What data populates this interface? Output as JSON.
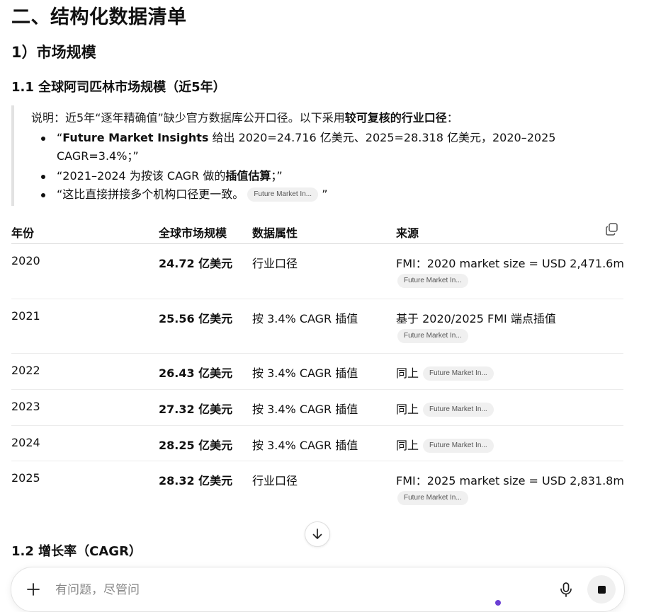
{
  "heading_main": "二、结构化数据清单",
  "section": "1）市场规模",
  "subsection": "1.1 全球阿司匹林市场规模（近5年）",
  "note": {
    "intro_prefix": "说明：近5年“逐年精确值”缺少官方数据库公开口径。以下采用",
    "intro_bold": "较可复核的行业口径",
    "intro_suffix": "：",
    "bullets": [
      {
        "open": "“",
        "bold": "Future Market Insights",
        "text": " 给出 2020=24.716 亿美元、2025=28.318 亿美元，2020–2025 CAGR=3.4%；”"
      },
      {
        "text_before": "“2021–2024 为按该 CAGR 做的",
        "bold": "插值估算",
        "text_after": "；”"
      },
      {
        "text": "“这比直接拼接多个机构口径更一致。",
        "chip": "Future Market In...",
        "close": "”"
      }
    ]
  },
  "table": {
    "headers": [
      "年份",
      "全球市场规模",
      "数据属性",
      "来源"
    ],
    "rows": [
      {
        "year": "2020",
        "size": "24.72 亿美元",
        "attr": "行业口径",
        "source": "FMI：2020 market size = USD 2,471.6m",
        "chip": "Future Market In..."
      },
      {
        "year": "2021",
        "size": "25.56 亿美元",
        "attr": "按 3.4% CAGR 插值",
        "source": "基于 2020/2025 FMI 端点插值",
        "chip": "Future Market In..."
      },
      {
        "year": "2022",
        "size": "26.43 亿美元",
        "attr": "按 3.4% CAGR 插值",
        "source": "同上",
        "chip": "Future Market In..."
      },
      {
        "year": "2023",
        "size": "27.32 亿美元",
        "attr": "按 3.4% CAGR 插值",
        "source": "同上",
        "chip": "Future Market In..."
      },
      {
        "year": "2024",
        "size": "28.25 亿美元",
        "attr": "按 3.4% CAGR 插值",
        "source": "同上",
        "chip": "Future Market In..."
      },
      {
        "year": "2025",
        "size": "28.32 亿美元",
        "attr": "行业口径",
        "source": "FMI：2025 market size = USD 2,831.8m",
        "chip": "Future Market In..."
      }
    ]
  },
  "next_subsection": "1.2 增长率（CAGR）",
  "composer": {
    "placeholder": "有问题，尽管问"
  },
  "icons": {
    "copy": "copy-icon",
    "scroll_down": "arrow-down-icon",
    "add": "plus-icon",
    "mic": "microphone-icon",
    "stop": "stop-icon"
  },
  "colors": {
    "accent_dot": "#6b3fd4",
    "chip_bg": "#f0f0f0"
  }
}
